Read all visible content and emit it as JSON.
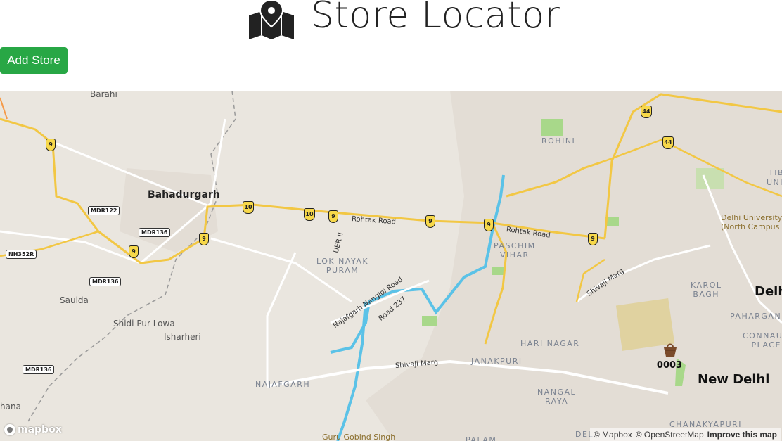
{
  "header": {
    "title": "Store Locator",
    "logo_icon": "map-marker-icon"
  },
  "toolbar": {
    "add_store_label": "Add Store",
    "add_store_color": "#28a745"
  },
  "map": {
    "places": {
      "barahi": "Barahi",
      "bahadurgarh": "Bahadurgarh",
      "rohini": "ROHINI",
      "paschim_vihar": "PASCHIM\nVIHAR",
      "lok_nayak_puram": "LOK NAYAK\nPURAM",
      "saulda": "Saulda",
      "shidi_pur_lowa": "Shidi Pur Lowa",
      "isharheri": "Isharheri",
      "najafgarh": "NAJAFGARH",
      "hari_nagar": "HARI NAGAR",
      "janakpuri": "JANAKPURI",
      "nangal_raya": "NANGAL\nRAYA",
      "karol_bagh": "KAROL\nBAGH",
      "paharganj": "PAHARGAN",
      "connaught_place": "CONNAUG\nPLACE",
      "chanakyapuri": "CHANAKYAPURI",
      "palam": "PALAM",
      "del": "DEL",
      "delhi_university": "Delhi University\n(North Campus",
      "delhi": "Delh",
      "new_delhi": "New Delhi",
      "guru_gobind_singh": "Guru Gobind Singh",
      "hana": "hana",
      "tib": "TIB",
      "univ": "UNIV"
    },
    "roads": {
      "rohtak_road_1": "Rohtak Road",
      "rohtak_road_2": "Rohtak Road",
      "uer_ii": "UER II",
      "najafgarh_nangloi": "Najafgarh Nangloi Road",
      "road_237": "Road 237",
      "shivaji_marg_1": "Shivaji Marg",
      "shivaji_marg_2": "Shivaji Marg"
    },
    "shields": {
      "s1": "9",
      "s2": "10",
      "s3": "10",
      "s4": "9",
      "s5": "9",
      "s6": "9",
      "s7": "9",
      "s8": "9",
      "s9": "9",
      "s10": "44",
      "s11": "44"
    },
    "road_markers": {
      "mdr122": "MDR122",
      "mdr136a": "MDR136",
      "mdr136b": "MDR136",
      "mdr136c": "MDR136",
      "nh352r": "NH352R"
    },
    "store": {
      "label": "0003",
      "icon": "shopping-bag-icon"
    },
    "mapbox_logo": "mapbox",
    "attribution": {
      "mapbox": "© Mapbox",
      "osm": "© OpenStreetMap",
      "improve": "Improve this map"
    },
    "colors": {
      "land": "#eae6df",
      "highway": "#f2c744",
      "river": "#5bc2e7",
      "park": "#a8d88a"
    }
  }
}
